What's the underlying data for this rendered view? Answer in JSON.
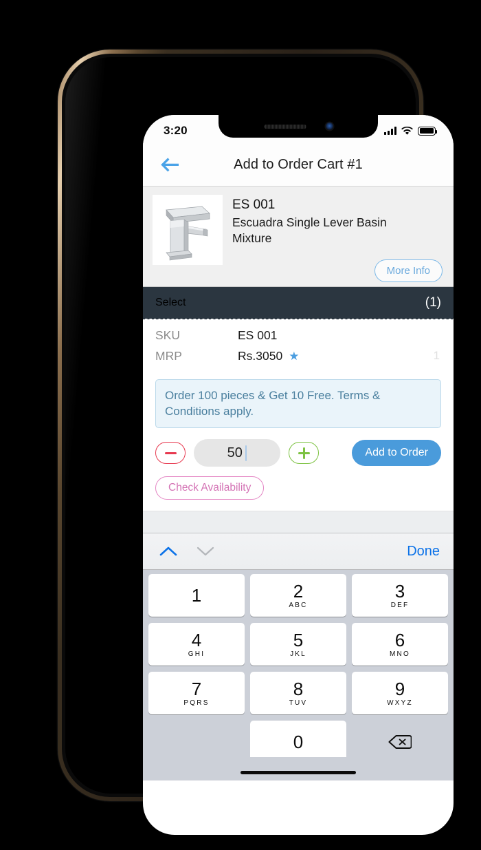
{
  "status_bar": {
    "time": "3:20",
    "signal_icon": "cellular-signal-icon",
    "wifi_icon": "wifi-icon",
    "battery_icon": "battery-full-icon"
  },
  "nav": {
    "back_icon": "back-arrow-icon",
    "title": "Add to Order Cart #1"
  },
  "product": {
    "image_alt": "basin-mixer-tap-image",
    "sku_title": "ES 001",
    "name": "Escuadra Single Lever Basin Mixture",
    "more_info_label": "More Info"
  },
  "select_bar": {
    "label": "Select",
    "count": "(1)"
  },
  "details": {
    "rows": [
      {
        "label": "SKU",
        "value": "ES 001"
      },
      {
        "label": "MRP",
        "value": "Rs.3050"
      }
    ],
    "star_icon": "star-icon",
    "quantity_hint": "1"
  },
  "offer": {
    "text": "Order 100 pieces & Get 10 Free. Terms & Conditions apply."
  },
  "stepper": {
    "minus_icon": "minus-icon",
    "plus_icon": "plus-icon",
    "quantity_value": "50",
    "add_to_order_label": "Add to Order",
    "check_availability_label": "Check Availability"
  },
  "keyboard_accessory": {
    "prev_icon": "chevron-up-icon",
    "next_icon": "chevron-down-icon",
    "done_label": "Done"
  },
  "keypad": {
    "keys": [
      {
        "digit": "1",
        "letters": ""
      },
      {
        "digit": "2",
        "letters": "ABC"
      },
      {
        "digit": "3",
        "letters": "DEF"
      },
      {
        "digit": "4",
        "letters": "GHI"
      },
      {
        "digit": "5",
        "letters": "JKL"
      },
      {
        "digit": "6",
        "letters": "MNO"
      },
      {
        "digit": "7",
        "letters": "PQRS"
      },
      {
        "digit": "8",
        "letters": "TUV"
      },
      {
        "digit": "9",
        "letters": "WXYZ"
      },
      {
        "digit": "0",
        "letters": ""
      }
    ],
    "delete_icon": "backspace-delete-icon"
  },
  "colors": {
    "accent_blue": "#4a9bdb",
    "link_blue": "#0b72e8",
    "select_bar_bg": "#2b3640",
    "offer_bg": "#eaf4fa",
    "offer_text": "#4a7f9e",
    "minus_red": "#e7394f",
    "plus_green": "#7dc242",
    "pink_outline": "#e486c4",
    "keypad_bg": "#ccd0d8"
  }
}
